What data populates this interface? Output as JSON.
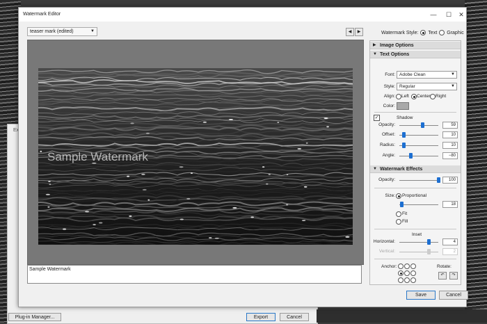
{
  "window": {
    "title": "Watermark Editor",
    "min": "—",
    "max": "☐",
    "close": "✕"
  },
  "toolbar": {
    "preset": "teaser mark (edited)",
    "prev": "◀",
    "next": "▶",
    "style_label": "Watermark Style:",
    "style_text": "Text",
    "style_graphic": "Graphic"
  },
  "preview": {
    "watermark_text": "Sample Watermark"
  },
  "text_input": "Sample Watermark",
  "panel": {
    "image_options": "Image Options",
    "text_options": "Text Options",
    "font_label": "Font:",
    "font_value": "Adobe Clean",
    "style_label": "Style:",
    "style_value": "Regular",
    "align_label": "Align:",
    "align_left": "Left",
    "align_center": "Center",
    "align_right": "Right",
    "color_label": "Color:",
    "color_value": "#a9a9a9",
    "shadow": {
      "label": "Shadow",
      "checked": true,
      "opacity_label": "Opacity:",
      "opacity": "59",
      "opacity_fraction": 0.59,
      "offset_label": "Offset:",
      "offset": "10",
      "offset_fraction": 0.1,
      "radius_label": "Radius:",
      "radius": "10",
      "radius_fraction": 0.1,
      "angle_label": "Angle:",
      "angle": "−80",
      "angle_fraction": 0.28
    },
    "effects": "Watermark Effects",
    "eff_opacity_label": "Opacity:",
    "eff_opacity": "100",
    "eff_opacity_fraction": 1.0,
    "size_label": "Size:",
    "size_proportional": "Proportional",
    "size_value": "18",
    "size_fraction": 0.06,
    "size_fit": "Fit",
    "size_fill": "Fill",
    "inset_label": "Inset",
    "horizontal_label": "Horizontal:",
    "horizontal": "4",
    "horizontal_fraction": 0.75,
    "vertical_label": "Vertical:",
    "vertical": "2",
    "vertical_fraction": 0.75,
    "anchor_label": "Anchor:",
    "rotate_label": "Rotate:",
    "rotate_ccw": "↶",
    "rotate_cw": "↷"
  },
  "buttons": {
    "save": "Save",
    "cancel": "Cancel"
  },
  "background_app": {
    "export_dialog_label": "Exp",
    "plugin_manager": "Plug-in Manager...",
    "export": "Export",
    "cancel": "Cancel"
  },
  "colors": {
    "accent": "#1d6fd1",
    "window_bg": "#f0f0f0"
  }
}
